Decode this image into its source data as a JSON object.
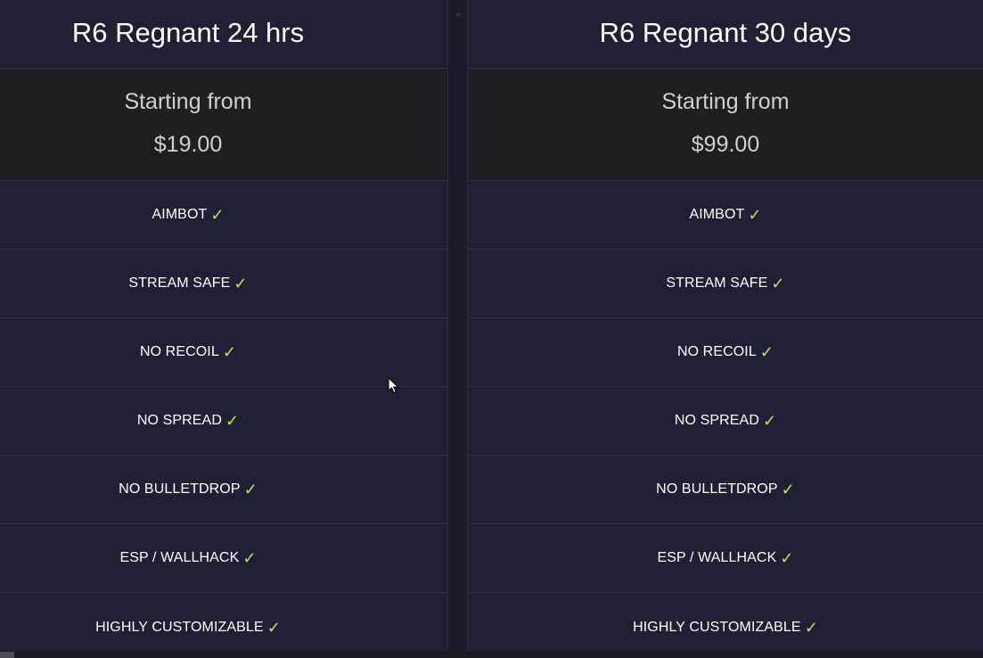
{
  "plans": [
    {
      "title": "R6 Regnant 24 hrs",
      "starting_label": "Starting from",
      "price": "$19.00",
      "features": [
        {
          "label": "AIMBOT",
          "check": "✓"
        },
        {
          "label": "STREAM SAFE",
          "check": "✓"
        },
        {
          "label": "NO RECOIL",
          "check": "✓"
        },
        {
          "label": "NO SPREAD",
          "check": "✓"
        },
        {
          "label": "NO BULLETDROP",
          "check": "✓"
        },
        {
          "label": "ESP / WALLHACK",
          "check": "✓"
        },
        {
          "label": "HIGHLY CUSTOMIZABLE",
          "check": "✓"
        }
      ]
    },
    {
      "title": "R6 Regnant 30 days",
      "starting_label": "Starting from",
      "price": "$99.00",
      "features": [
        {
          "label": "AIMBOT",
          "check": "✓"
        },
        {
          "label": "STREAM SAFE",
          "check": "✓"
        },
        {
          "label": "NO RECOIL",
          "check": "✓"
        },
        {
          "label": "NO SPREAD",
          "check": "✓"
        },
        {
          "label": "NO BULLETDROP",
          "check": "✓"
        },
        {
          "label": "ESP / WALLHACK",
          "check": "✓"
        },
        {
          "label": "HIGHLY CUSTOMIZABLE",
          "check": "✓"
        }
      ]
    }
  ],
  "colors": {
    "card_bg": "#1e2036",
    "price_bg": "#1e1f22",
    "check": "#b9e34a",
    "divider": "#2d3042"
  },
  "icons": {
    "check": "check-icon",
    "cursor": "mouse-cursor-icon"
  }
}
